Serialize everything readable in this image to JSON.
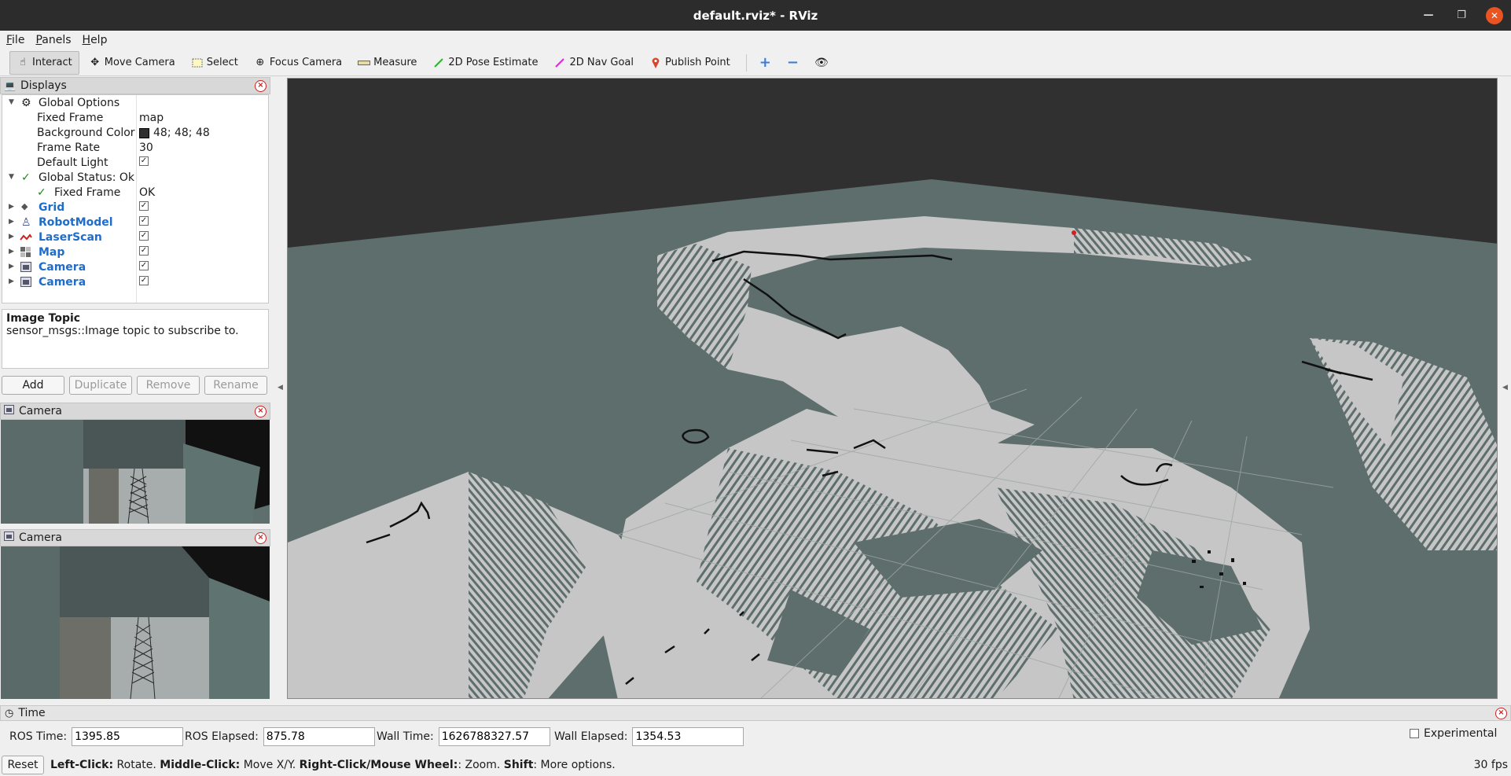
{
  "window": {
    "title": "default.rviz* - RViz"
  },
  "menu": {
    "items": [
      "File",
      "Panels",
      "Help"
    ]
  },
  "toolbar": {
    "tools": [
      {
        "label": "Interact",
        "icon": "hand-icon",
        "active": true
      },
      {
        "label": "Move Camera",
        "icon": "move-camera-icon"
      },
      {
        "label": "Select",
        "icon": "select-icon"
      },
      {
        "label": "Focus Camera",
        "icon": "focus-camera-icon"
      },
      {
        "label": "Measure",
        "icon": "ruler-icon"
      },
      {
        "label": "2D Pose Estimate",
        "icon": "green-arrow-icon"
      },
      {
        "label": "2D Nav Goal",
        "icon": "magenta-arrow-icon"
      },
      {
        "label": "Publish Point",
        "icon": "map-pin-icon"
      }
    ]
  },
  "displays": {
    "title": "Displays",
    "global_options": "Global Options",
    "fixed_frame": {
      "key": "Fixed Frame",
      "value": "map"
    },
    "background_color": {
      "key": "Background Color",
      "value": "48; 48; 48",
      "color": "#303030"
    },
    "frame_rate": {
      "key": "Frame Rate",
      "value": "30"
    },
    "default_light": {
      "key": "Default Light",
      "checked": true
    },
    "global_status": "Global Status: Ok",
    "status_fixed_frame": {
      "key": "Fixed Frame",
      "value": "OK"
    },
    "items": [
      {
        "label": "Grid",
        "enabled": true
      },
      {
        "label": "RobotModel",
        "enabled": true
      },
      {
        "label": "LaserScan",
        "enabled": true
      },
      {
        "label": "Map",
        "enabled": true
      },
      {
        "label": "Camera",
        "enabled": true
      },
      {
        "label": "Camera",
        "enabled": true
      }
    ],
    "description": {
      "title": "Image Topic",
      "text": "sensor_msgs::Image topic to subscribe to."
    },
    "buttons": {
      "add": "Add",
      "duplicate": "Duplicate",
      "remove": "Remove",
      "rename": "Rename"
    }
  },
  "camera_panels": [
    {
      "title": "Camera"
    },
    {
      "title": "Camera"
    }
  ],
  "time": {
    "title": "Time",
    "ros_time": {
      "label": "ROS Time:",
      "value": "1395.85"
    },
    "ros_elapsed": {
      "label": "ROS Elapsed:",
      "value": "875.78"
    },
    "wall_time": {
      "label": "Wall Time:",
      "value": "1626788327.57"
    },
    "wall_elapsed": {
      "label": "Wall Elapsed:",
      "value": "1354.53"
    },
    "experimental": "Experimental"
  },
  "status": {
    "reset": "Reset",
    "hint_parts": [
      {
        "b": "Left-Click:",
        "t": " Rotate. "
      },
      {
        "b": "Middle-Click:",
        "t": " Move X/Y. "
      },
      {
        "b": "Right-Click/Mouse Wheel:",
        "t": ": Zoom. "
      },
      {
        "b": "Shift",
        "t": ": More options."
      }
    ],
    "fps": "30 fps"
  },
  "colors": {
    "accent_blue": "#1f6cc9",
    "map_free": "#c6c6c6",
    "map_unknown": "#5d6e6c",
    "bg": "#303030"
  }
}
